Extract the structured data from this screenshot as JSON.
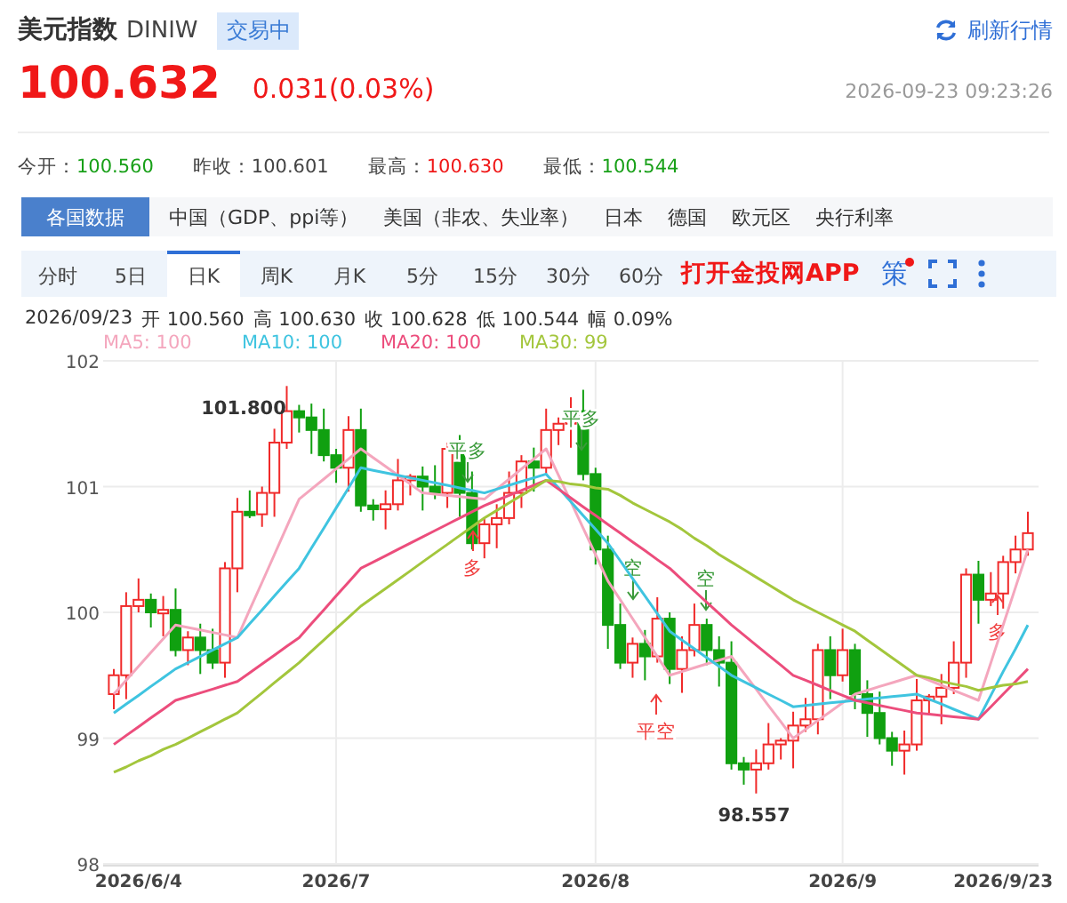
{
  "header": {
    "title": "美元指数",
    "code": "DINIW",
    "status": "交易中",
    "refresh": "刷新行情"
  },
  "quote": {
    "price": "100.632",
    "change": "0.031(0.03%)",
    "time": "2026-09-23 09:23:26"
  },
  "stats": [
    {
      "label": "今开：",
      "value": "100.560",
      "color": "#18a018"
    },
    {
      "label": "昨收：",
      "value": "100.601",
      "color": "#444444"
    },
    {
      "label": "最高：",
      "value": "100.630",
      "color": "#f01818"
    },
    {
      "label": "最低：",
      "value": "100.544",
      "color": "#18a018"
    }
  ],
  "country_tabs": [
    {
      "label": "各国数据",
      "selected": true
    },
    {
      "label": "中国（GDP、ppi等）",
      "selected": false
    },
    {
      "label": "美国（非农、失业率）",
      "selected": false
    },
    {
      "label": "日本",
      "selected": false
    },
    {
      "label": "德国",
      "selected": false
    },
    {
      "label": "欧元区",
      "selected": false
    },
    {
      "label": "央行利率",
      "selected": false
    }
  ],
  "period_tabs": [
    {
      "label": "分时",
      "selected": false
    },
    {
      "label": "5日",
      "selected": false
    },
    {
      "label": "日K",
      "selected": true
    },
    {
      "label": "周K",
      "selected": false
    },
    {
      "label": "月K",
      "selected": false
    },
    {
      "label": "5分",
      "selected": false
    },
    {
      "label": "15分",
      "selected": false
    },
    {
      "label": "30分",
      "selected": false
    },
    {
      "label": "60分",
      "selected": false
    }
  ],
  "app_link": "打开金投网APP",
  "strategy": {
    "label": "策",
    "has_dot": true
  },
  "ohlc": [
    "2026/09/23",
    "开 100.560",
    "高 100.630",
    "收 100.628",
    "低 100.544",
    "幅 0.09%"
  ],
  "chart": {
    "high_label": "101.800",
    "low_label": "98.557",
    "signals": [
      {
        "label": "平多",
        "kind": "down",
        "color": "#3a9a3a"
      },
      {
        "label": "多",
        "kind": "up",
        "color": "#f03c3c"
      },
      {
        "label": "平多",
        "kind": "down",
        "color": "#3a9a3a"
      },
      {
        "label": "空",
        "kind": "down",
        "color": "#3a9a3a"
      },
      {
        "label": "平空",
        "kind": "up",
        "color": "#f03c3c"
      },
      {
        "label": "空",
        "kind": "down",
        "color": "#3a9a3a"
      },
      {
        "label": "多",
        "kind": "up",
        "color": "#f03c3c"
      }
    ],
    "chart_data": {
      "type": "candlestick",
      "categories": [
        null,
        null,
        "2026/6/4",
        null,
        null,
        null,
        null,
        null,
        null,
        null,
        null,
        null,
        null,
        null,
        null,
        null,
        null,
        null,
        "2026/7",
        null,
        null,
        null,
        null,
        null,
        null,
        null,
        null,
        null,
        null,
        null,
        null,
        null,
        null,
        null,
        null,
        null,
        null,
        null,
        null,
        "2026/8",
        null,
        null,
        null,
        null,
        null,
        null,
        null,
        null,
        null,
        null,
        null,
        null,
        null,
        null,
        null,
        null,
        null,
        null,
        null,
        "2026/9",
        null,
        null,
        null,
        null,
        null,
        null,
        null,
        null,
        null,
        null,
        null,
        null,
        "2026/9/23",
        null,
        null
      ],
      "ylim": [
        98,
        102
      ],
      "yticks": [
        98,
        99,
        100,
        101,
        102
      ],
      "grid": true,
      "ohlc": [
        [
          99.35,
          99.55,
          99.23,
          99.5
        ],
        [
          99.5,
          100.16,
          99.31,
          100.05
        ],
        [
          100.05,
          100.27,
          100.0,
          100.1
        ],
        [
          100.1,
          100.15,
          99.88,
          100.0
        ],
        [
          100.0,
          100.13,
          99.81,
          100.02
        ],
        [
          100.02,
          100.19,
          99.65,
          99.7
        ],
        [
          99.7,
          99.85,
          99.58,
          99.8
        ],
        [
          99.8,
          99.91,
          99.51,
          99.7
        ],
        [
          99.7,
          99.87,
          99.55,
          99.6
        ],
        [
          99.6,
          100.4,
          99.48,
          100.35
        ],
        [
          100.35,
          100.91,
          100.16,
          100.8
        ],
        [
          100.8,
          100.97,
          100.75,
          100.78
        ],
        [
          100.78,
          101.0,
          100.68,
          100.95
        ],
        [
          100.95,
          101.46,
          100.76,
          101.35
        ],
        [
          101.35,
          101.8,
          101.3,
          101.6
        ],
        [
          101.6,
          101.65,
          101.43,
          101.55
        ],
        [
          101.55,
          101.66,
          101.26,
          101.45
        ],
        [
          101.45,
          101.62,
          101.2,
          101.25
        ],
        [
          101.25,
          101.3,
          101.03,
          101.15
        ],
        [
          101.15,
          101.56,
          100.96,
          101.45
        ],
        [
          101.45,
          101.62,
          100.8,
          100.85
        ],
        [
          100.85,
          100.9,
          100.73,
          100.82
        ],
        [
          100.82,
          100.97,
          100.66,
          100.86
        ],
        [
          100.86,
          101.22,
          100.81,
          101.05
        ],
        [
          101.05,
          101.1,
          100.93,
          101.08
        ],
        [
          101.08,
          101.16,
          100.81,
          101.0
        ],
        [
          101.0,
          101.17,
          100.9,
          100.95
        ],
        [
          100.95,
          101.35,
          100.83,
          101.3
        ],
        [
          101.3,
          101.41,
          100.76,
          100.95
        ],
        [
          100.95,
          101.12,
          100.5,
          100.55
        ],
        [
          100.55,
          100.75,
          100.43,
          100.7
        ],
        [
          100.7,
          100.86,
          100.51,
          100.75
        ],
        [
          100.75,
          101.12,
          100.7,
          100.95
        ],
        [
          100.95,
          101.25,
          100.83,
          101.2
        ],
        [
          101.2,
          101.31,
          100.96,
          101.15
        ],
        [
          101.15,
          101.62,
          101.1,
          101.45
        ],
        [
          101.45,
          101.55,
          101.33,
          101.5
        ],
        [
          101.5,
          101.71,
          101.31,
          101.6
        ],
        [
          101.6,
          101.77,
          101.05,
          101.1
        ],
        [
          101.1,
          101.15,
          100.38,
          100.5
        ],
        [
          100.5,
          100.61,
          99.71,
          99.9
        ],
        [
          99.9,
          100.07,
          99.55,
          99.6
        ],
        [
          99.6,
          99.8,
          99.48,
          99.75
        ],
        [
          99.75,
          99.86,
          99.46,
          99.65
        ],
        [
          99.65,
          100.12,
          99.6,
          99.95
        ],
        [
          99.95,
          100.0,
          99.43,
          99.55
        ],
        [
          99.55,
          99.81,
          99.36,
          99.7
        ],
        [
          99.7,
          100.07,
          99.65,
          99.9
        ],
        [
          99.9,
          99.95,
          99.58,
          99.7
        ],
        [
          99.7,
          99.81,
          99.41,
          99.6
        ],
        [
          99.6,
          99.77,
          98.75,
          98.8
        ],
        [
          98.8,
          98.85,
          98.63,
          98.75
        ],
        [
          98.75,
          98.91,
          98.56,
          98.8
        ],
        [
          98.8,
          99.12,
          98.75,
          98.95
        ],
        [
          98.95,
          99.0,
          98.83,
          98.98
        ],
        [
          98.98,
          99.21,
          98.76,
          99.1
        ],
        [
          99.1,
          99.32,
          99.05,
          99.15
        ],
        [
          99.15,
          99.75,
          99.03,
          99.7
        ],
        [
          99.7,
          99.81,
          99.31,
          99.5
        ],
        [
          99.5,
          99.87,
          99.45,
          99.7
        ],
        [
          99.7,
          99.75,
          99.23,
          99.35
        ],
        [
          99.35,
          99.46,
          99.01,
          99.2
        ],
        [
          99.2,
          99.37,
          98.95,
          99.0
        ],
        [
          99.0,
          99.05,
          98.78,
          98.9
        ],
        [
          98.9,
          99.06,
          98.71,
          98.95
        ],
        [
          98.95,
          99.47,
          98.9,
          99.3
        ],
        [
          99.3,
          99.35,
          99.18,
          99.33
        ],
        [
          99.33,
          99.51,
          99.11,
          99.4
        ],
        [
          99.4,
          99.77,
          99.35,
          99.6
        ],
        [
          99.6,
          100.35,
          99.48,
          100.3
        ],
        [
          100.3,
          100.41,
          99.91,
          100.1
        ],
        [
          100.1,
          100.32,
          100.05,
          100.15
        ],
        [
          100.15,
          100.45,
          100.03,
          100.4
        ],
        [
          100.4,
          100.61,
          100.31,
          100.5
        ],
        [
          100.5,
          100.8,
          100.45,
          100.63
        ]
      ]
    },
    "moving_averages": {
      "chart_data": {
        "type": "line",
        "categories": [
          null,
          null,
          null,
          null,
          null,
          null,
          null,
          null,
          null,
          null,
          null,
          null,
          null,
          null,
          null,
          null,
          null,
          null,
          null,
          null,
          null,
          null,
          null,
          null,
          null,
          null,
          null,
          null,
          null,
          null,
          null,
          null,
          null,
          null,
          null,
          null,
          null,
          null,
          null,
          null,
          null,
          null,
          null,
          null,
          null,
          null,
          null,
          null,
          null,
          null,
          null,
          null,
          null,
          null,
          null,
          null,
          null,
          null,
          null,
          null,
          null,
          null,
          null,
          null,
          null,
          null,
          null,
          null,
          null,
          null,
          null,
          null,
          null,
          null,
          null
        ],
        "ylim": [
          98,
          102
        ],
        "series": [
          {
            "name": "MA5: 100",
            "color": "#f4a6bd",
            "values": [
              99.35,
              99.46,
              99.57,
              99.68,
              99.79,
              99.9,
              99.88,
              99.86,
              99.84,
              99.82,
              99.8,
              100.02,
              100.24,
              100.46,
              100.68,
              100.9,
              100.98,
              101.06,
              101.14,
              101.22,
              101.3,
              101.23,
              101.16,
              101.09,
              101.02,
              100.95,
              100.94,
              100.93,
              100.92,
              100.91,
              100.9,
              100.98,
              101.06,
              101.14,
              101.22,
              101.3,
              101.09,
              100.88,
              100.67,
              100.46,
              100.25,
              100.1,
              99.95,
              99.8,
              99.65,
              99.5,
              99.53,
              99.56,
              99.59,
              99.62,
              99.65,
              99.52,
              99.39,
              99.26,
              99.13,
              99.0,
              99.07,
              99.14,
              99.21,
              99.28,
              99.35,
              99.38,
              99.41,
              99.44,
              99.47,
              99.5,
              99.46,
              99.42,
              99.38,
              99.34,
              99.3,
              99.6,
              99.9,
              100.2,
              100.5
            ]
          },
          {
            "name": "MA10: 100",
            "color": "#3fc4e0",
            "values": [
              99.2,
              99.27,
              99.34,
              99.41,
              99.48,
              99.55,
              99.6,
              99.65,
              99.7,
              99.75,
              99.8,
              99.91,
              100.02,
              100.13,
              100.24,
              100.35,
              100.51,
              100.67,
              100.83,
              100.99,
              101.15,
              101.13,
              101.11,
              101.09,
              101.07,
              101.05,
              101.03,
              101.01,
              100.99,
              100.97,
              100.95,
              100.98,
              101.01,
              101.04,
              101.07,
              101.1,
              100.99,
              100.88,
              100.77,
              100.66,
              100.55,
              100.41,
              100.27,
              100.13,
              99.99,
              99.85,
              99.78,
              99.71,
              99.64,
              99.57,
              99.5,
              99.45,
              99.4,
              99.35,
              99.3,
              99.25,
              99.26,
              99.27,
              99.28,
              99.29,
              99.3,
              99.31,
              99.32,
              99.33,
              99.34,
              99.35,
              99.31,
              99.27,
              99.23,
              99.19,
              99.15,
              99.34,
              99.53,
              99.71,
              99.9
            ]
          },
          {
            "name": "MA20: 100",
            "color": "#ec4d7c",
            "values": [
              98.95,
              99.02,
              99.09,
              99.16,
              99.23,
              99.3,
              99.33,
              99.36,
              99.39,
              99.42,
              99.45,
              99.52,
              99.59,
              99.66,
              99.73,
              99.8,
              99.91,
              100.02,
              100.13,
              100.24,
              100.35,
              100.4,
              100.45,
              100.5,
              100.55,
              100.6,
              100.65,
              100.7,
              100.75,
              100.8,
              100.85,
              100.89,
              100.93,
              100.97,
              101.01,
              101.05,
              100.98,
              100.91,
              100.84,
              100.77,
              100.7,
              100.63,
              100.56,
              100.49,
              100.42,
              100.35,
              100.26,
              100.17,
              100.08,
              99.99,
              99.9,
              99.82,
              99.74,
              99.66,
              99.58,
              99.5,
              99.46,
              99.42,
              99.38,
              99.34,
              99.3,
              99.28,
              99.26,
              99.24,
              99.22,
              99.2,
              99.19,
              99.18,
              99.17,
              99.16,
              99.15,
              99.25,
              99.35,
              99.45,
              99.55
            ]
          },
          {
            "name": "MA30: 99",
            "color": "#a3c63c",
            "values": [
              98.73,
              98.77,
              98.82,
              98.86,
              98.91,
              98.95,
              99.0,
              99.05,
              99.1,
              99.15,
              99.2,
              99.28,
              99.36,
              99.44,
              99.52,
              99.6,
              99.69,
              99.78,
              99.87,
              99.96,
              100.05,
              100.12,
              100.19,
              100.26,
              100.33,
              100.4,
              100.47,
              100.54,
              100.61,
              100.68,
              100.75,
              100.81,
              100.87,
              100.93,
              100.99,
              101.05,
              101.04,
              101.02,
              101.01,
              100.99,
              100.98,
              100.93,
              100.87,
              100.82,
              100.77,
              100.72,
              100.66,
              100.59,
              100.53,
              100.46,
              100.4,
              100.34,
              100.28,
              100.22,
              100.16,
              100.1,
              100.05,
              100.0,
              99.95,
              99.9,
              99.85,
              99.78,
              99.71,
              99.64,
              99.57,
              99.5,
              99.48,
              99.45,
              99.43,
              99.41,
              99.38,
              99.4,
              99.42,
              99.43,
              99.45
            ]
          }
        ]
      }
    }
  }
}
